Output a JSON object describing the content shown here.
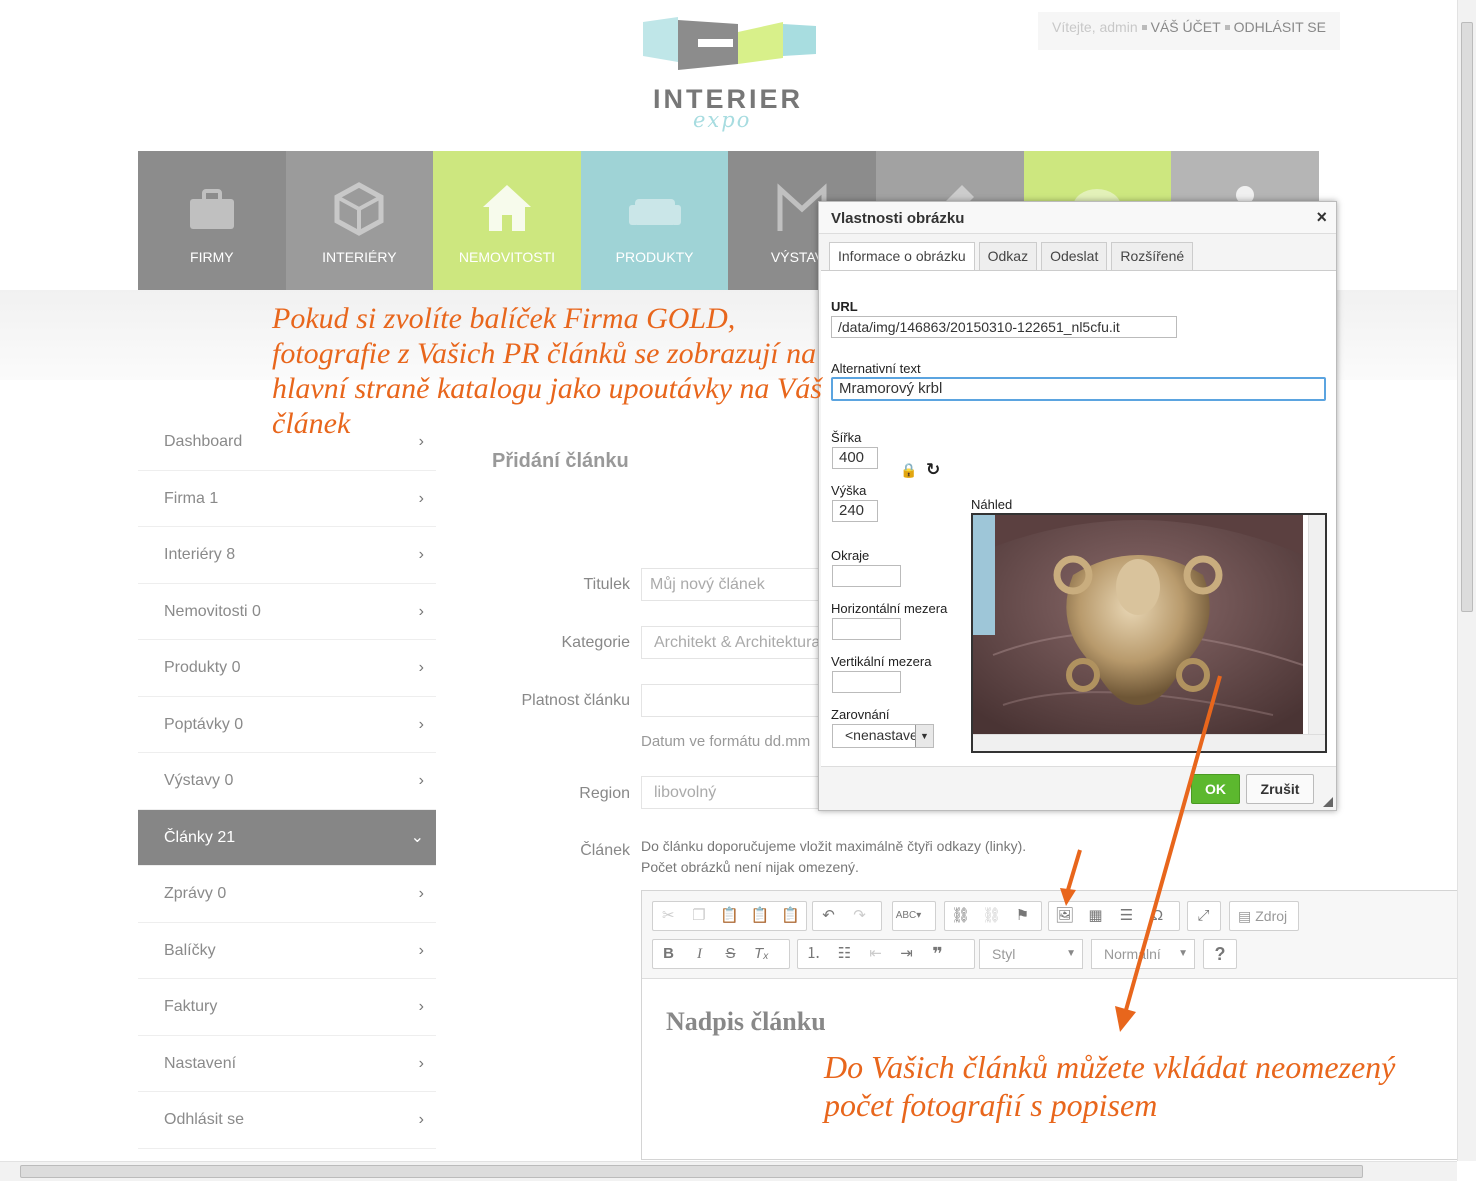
{
  "topbar": {
    "welcome": "Vítejte, admin",
    "account": "VÁŠ ÚČET",
    "logout": "ODHLÁSIT SE"
  },
  "logo": {
    "brand": "INTERIER",
    "sub": "expo"
  },
  "nav": [
    {
      "label": "FIRMY",
      "color": "#8c8c8c",
      "icon": "briefcase-icon"
    },
    {
      "label": "INTERIÉRY",
      "color": "#9b9b9b",
      "icon": "cube-icon"
    },
    {
      "label": "NEMOVITOSTI",
      "color": "#cde77f",
      "icon": "house-icon"
    },
    {
      "label": "PRODUKTY",
      "color": "#9fd3d6",
      "icon": "sofa-icon"
    },
    {
      "label": "VÝSTAVY",
      "color": "#8c8c8c",
      "icon": "exhibition-icon"
    },
    {
      "label": "",
      "color": "#a2a2a2",
      "icon": "pencil-icon"
    },
    {
      "label": "",
      "color": "#cde77f",
      "icon": "chat-icon"
    },
    {
      "label": "",
      "color": "#b5b5b5",
      "icon": "user-icon"
    }
  ],
  "annotations": {
    "note1": "Pokud si zvolíte balíček Firma GOLD, fotografie z Vašich PR článků se zobrazují na hlavní straně katalogu jako upoutávky na Váš článek",
    "note2": "Do Vašich článků můžete vkládat neomezený počet fotografií s popisem"
  },
  "sidebar": [
    {
      "label": "Dashboard",
      "active": false
    },
    {
      "label": "Firma 1",
      "active": false
    },
    {
      "label": "Interiéry 8",
      "active": false
    },
    {
      "label": "Nemovitosti 0",
      "active": false
    },
    {
      "label": "Produkty 0",
      "active": false
    },
    {
      "label": "Poptávky 0",
      "active": false
    },
    {
      "label": "Výstavy 0",
      "active": false
    },
    {
      "label": "Články 21",
      "active": true
    },
    {
      "label": "Zprávy 0",
      "active": false
    },
    {
      "label": "Balíčky",
      "active": false
    },
    {
      "label": "Faktury",
      "active": false
    },
    {
      "label": "Nastavení",
      "active": false
    },
    {
      "label": "Odhlásit se",
      "active": false
    }
  ],
  "form": {
    "title": "Přidání článku",
    "titulek_label": "Titulek",
    "titulek_placeholder": "Můj nový článek",
    "kategorie_label": "Kategorie",
    "kategorie_value": "Architekt & Architektura",
    "platnost_label": "Platnost článku",
    "platnost_hint": "Datum ve formátu dd.mm",
    "region_label": "Region",
    "region_value": "libovolný",
    "clanek_label": "Článek",
    "clanek_hint1": "Do článku doporučujeme vložit maximálně čtyři odkazy (linky).",
    "clanek_hint2": "Počet obrázků není nijak omezený."
  },
  "editor": {
    "source_label": "Zdroj",
    "style_label": "Styl",
    "format_label": "Normální",
    "heading": "Nadpis článku"
  },
  "dialog": {
    "title": "Vlastnosti obrázku",
    "close": "×",
    "tabs": [
      "Informace o obrázku",
      "Odkaz",
      "Odeslat",
      "Rozšířené"
    ],
    "url_label": "URL",
    "url_value": "/data/img/146863/20150310-122651_nl5cfu.it",
    "alt_label": "Alternativní text",
    "alt_value": "Mramorový krbl",
    "width_label": "Šířka",
    "width_value": "400",
    "height_label": "Výška",
    "height_value": "240",
    "border_label": "Okraje",
    "hspace_label": "Horizontální mezera",
    "vspace_label": "Vertikální mezera",
    "align_label": "Zarovnání",
    "align_value": "<nenastaveno>",
    "preview_label": "Náhled",
    "ok": "OK",
    "cancel": "Zrušit"
  }
}
